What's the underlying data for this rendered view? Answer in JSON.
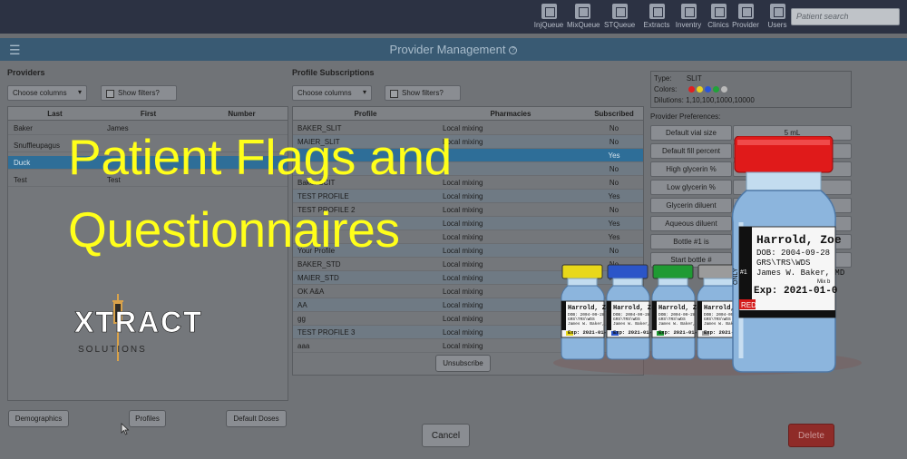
{
  "toolbar": {
    "items": [
      {
        "label": "InjQueue",
        "icon": "injection-queue-icon"
      },
      {
        "label": "MixQueue",
        "icon": "mix-queue-icon"
      },
      {
        "label": "STQueue",
        "icon": "skin-test-queue-icon"
      },
      {
        "label": "Extracts",
        "icon": "extracts-icon"
      },
      {
        "label": "Inventry",
        "icon": "inventory-icon"
      },
      {
        "label": "Clinics",
        "icon": "clinics-icon"
      },
      {
        "label": "Provider",
        "icon": "provider-icon"
      },
      {
        "label": "Users",
        "icon": "users-icon"
      }
    ],
    "search_placeholder": "Patient search"
  },
  "header": {
    "menu_icon": "☰",
    "title": "Provider Management",
    "help_icon": "?"
  },
  "providers": {
    "heading": "Providers",
    "choose_columns": "Choose columns",
    "show_filters": "Show filters?",
    "columns": [
      "Last",
      "First",
      "Number"
    ],
    "rows": [
      {
        "last": "Baker",
        "first": "James",
        "number": ""
      },
      {
        "last": "Snuffleupagus",
        "first": "",
        "number": ""
      },
      {
        "last": "Duck",
        "first": "",
        "number": ""
      },
      {
        "last": "Test",
        "first": "Test",
        "number": ""
      }
    ],
    "selected_index": 2
  },
  "subscriptions": {
    "heading": "Profile Subscriptions",
    "choose_columns": "Choose columns",
    "show_filters": "Show filters?",
    "columns": [
      "Profile",
      "Pharmacies",
      "Subscribed"
    ],
    "rows": [
      {
        "profile": "BAKER_SLIT",
        "pharmacy": "Local mixing",
        "subscribed": "No"
      },
      {
        "profile": "MAIER_SLIT",
        "pharmacy": "Local mixing",
        "subscribed": "No"
      },
      {
        "profile": "",
        "pharmacy": "",
        "subscribed": "Yes"
      },
      {
        "profile": "",
        "pharmacy": "",
        "subscribed": "No"
      },
      {
        "profile": "Baker SCIT",
        "pharmacy": "Local mixing",
        "subscribed": "No"
      },
      {
        "profile": "TEST PROFILE",
        "pharmacy": "Local mixing",
        "subscribed": "Yes"
      },
      {
        "profile": "TEST PROFILE 2",
        "pharmacy": "Local mixing",
        "subscribed": "No"
      },
      {
        "profile": "",
        "pharmacy": "Local mixing",
        "subscribed": "Yes"
      },
      {
        "profile": "",
        "pharmacy": "Local mixing",
        "subscribed": "Yes"
      },
      {
        "profile": "Your Profile",
        "pharmacy": "Local mixing",
        "subscribed": "No"
      },
      {
        "profile": "BAKER_STD",
        "pharmacy": "Local mixing",
        "subscribed": "No"
      },
      {
        "profile": "MAIER_STD",
        "pharmacy": "Local mixing",
        "subscribed": "No"
      },
      {
        "profile": "OK A&A",
        "pharmacy": "Local mixing",
        "subscribed": ""
      },
      {
        "profile": "AA",
        "pharmacy": "Local mixing",
        "subscribed": ""
      },
      {
        "profile": "gg",
        "pharmacy": "Local mixing",
        "subscribed": ""
      },
      {
        "profile": "TEST PROFILE 3",
        "pharmacy": "Local mixing",
        "subscribed": ""
      },
      {
        "profile": "aaa",
        "pharmacy": "Local mixing",
        "subscribed": ""
      }
    ],
    "selected_index": 2,
    "unsubscribe": "Unsubscribe"
  },
  "details": {
    "type_label": "Type:",
    "type_value": "SLIT",
    "colors_label": "Colors:",
    "colors": [
      "#e02020",
      "#e8d020",
      "#2a55d8",
      "#21a23a",
      "#b9b9b9"
    ],
    "dilutions_label": "Dilutions:",
    "dilutions_value": "1,10,100,1000,10000",
    "prefs_heading": "Provider Preferences:",
    "prefs": [
      {
        "label": "Default vial size",
        "value": "5 mL"
      },
      {
        "label": "Default fill percent",
        "value": "100"
      },
      {
        "label": "High glycerin %",
        "value": "50"
      },
      {
        "label": "Low glycerin %",
        "value": "0"
      },
      {
        "label": "Glycerin diluent",
        "value": ""
      },
      {
        "label": "Aqueous diluent",
        "value": ""
      },
      {
        "label": "Bottle #1 is",
        "value": ""
      },
      {
        "label": "Start bottle #",
        "value": ""
      }
    ]
  },
  "buttons": {
    "demographics": "Demographics",
    "profiles": "Profiles",
    "default_doses": "Default Doses",
    "cancel": "Cancel",
    "delete": "Delete"
  },
  "overlay": {
    "headline_line1": "Patient Flags and",
    "headline_line2": "Questionnaires",
    "logo_main": "XTRACT",
    "logo_sub": "S O L U T I O N S",
    "vial": {
      "name": "Harrold, Zoe",
      "dob": "DOB: 2004-09-28",
      "code": "GRS\\TRS\\WDS",
      "provider": "James W. Baker, MD",
      "exp": "Exp: 2021-01-0",
      "tag": "RED",
      "side_text": "ONLY",
      "hash": "#1",
      "mix": "Mix b"
    },
    "small_vials": {
      "name": "Harrold, Zoe",
      "dob": "DOB: 2004-09-28",
      "code": "GRS\\TRS\\WDS",
      "provider": "James W. Baker, MD",
      "exp": "Exp: 2021-01-0",
      "caps": [
        "#e8d81a",
        "#2b55c8",
        "#1f9a33",
        "#9b9b9b"
      ]
    }
  }
}
